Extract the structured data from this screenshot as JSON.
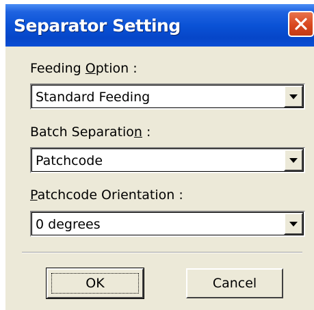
{
  "dialog": {
    "title": "Separator Setting",
    "close_icon": "close-icon"
  },
  "fields": {
    "feeding_option": {
      "label_pre": "Feeding ",
      "label_ul": "O",
      "label_post": "ption :",
      "value": "Standard Feeding"
    },
    "batch_separation": {
      "label_pre": "Batch Separatio",
      "label_ul": "n",
      "label_post": " :",
      "value": "Patchcode"
    },
    "patchcode_orientation": {
      "label_pre": "",
      "label_ul": "P",
      "label_post": "atchcode Orientation :",
      "value": "0 degrees"
    }
  },
  "buttons": {
    "ok": "OK",
    "cancel": "Cancel"
  },
  "colors": {
    "title_bar": "#0a52d6",
    "dialog_bg": "#ece9d8",
    "close_button": "#d9471f"
  }
}
